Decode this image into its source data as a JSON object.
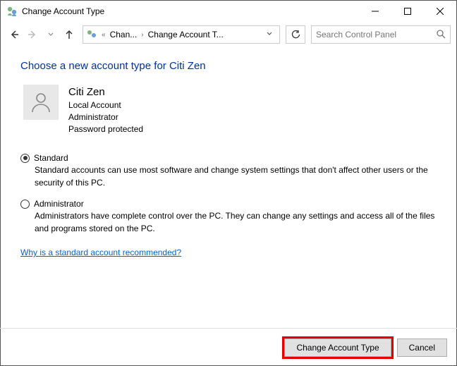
{
  "window": {
    "title": "Change Account Type"
  },
  "breadcrumb": {
    "item1": "Chan...",
    "item2": "Change Account T..."
  },
  "search": {
    "placeholder": "Search Control Panel"
  },
  "heading": "Choose a new account type for Citi Zen",
  "user": {
    "name": "Citi Zen",
    "type": "Local Account",
    "role": "Administrator",
    "pw": "Password protected"
  },
  "options": {
    "standard": {
      "label": "Standard",
      "desc": "Standard accounts can use most software and change system settings that don't affect other users or the security of this PC."
    },
    "admin": {
      "label": "Administrator",
      "desc": "Administrators have complete control over the PC. They can change any settings and access all of the files and programs stored on the PC."
    }
  },
  "helplink": "Why is a standard account recommended?",
  "buttons": {
    "change": "Change Account Type",
    "cancel": "Cancel"
  }
}
